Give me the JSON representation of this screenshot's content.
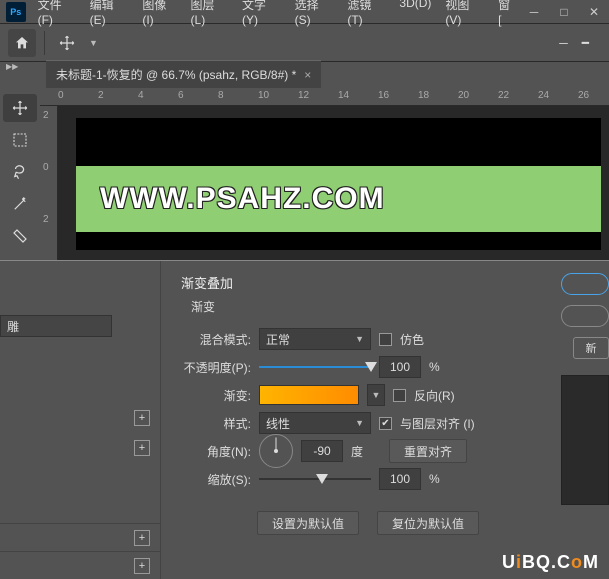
{
  "titlebar": {
    "logo": "Ps",
    "menus": [
      "文件(F)",
      "编辑(E)",
      "图像(I)",
      "图层(L)",
      "文字(Y)",
      "选择(S)",
      "滤镜(T)",
      "3D(D)",
      "视图(V)",
      "窗["
    ]
  },
  "doc_tab": {
    "title": "未标题-1-恢复的 @ 66.7% (psahz, RGB/8#) *",
    "close": "×"
  },
  "ruler_h": [
    "0",
    "2",
    "4",
    "6",
    "8",
    "10",
    "12",
    "14",
    "16",
    "18",
    "20",
    "22",
    "24",
    "26"
  ],
  "ruler_v": [
    "2",
    "0",
    "2"
  ],
  "canvas_text": "WWW.PSAHZ.COM",
  "dialog": {
    "title": "渐变叠加",
    "sub": "渐变",
    "left_item": "雕",
    "blend_label": "混合模式:",
    "blend_value": "正常",
    "dither": "仿色",
    "opacity_label": "不透明度(P):",
    "opacity_value": "100",
    "pct": "%",
    "gradient_label": "渐变:",
    "reverse": "反向(R)",
    "style_label": "样式:",
    "style_value": "线性",
    "align": "与图层对齐 (I)",
    "angle_label": "角度(N):",
    "angle_value": "-90",
    "angle_unit": "度",
    "reset_align": "重置对齐",
    "scale_label": "缩放(S):",
    "scale_value": "100",
    "set_default": "设置为默认值",
    "reset_default": "复位为默认值",
    "right_new": "新"
  },
  "watermark": {
    "a": "U",
    "b": "i",
    "c": "BQ.C",
    "d": "o",
    "e": "M"
  }
}
